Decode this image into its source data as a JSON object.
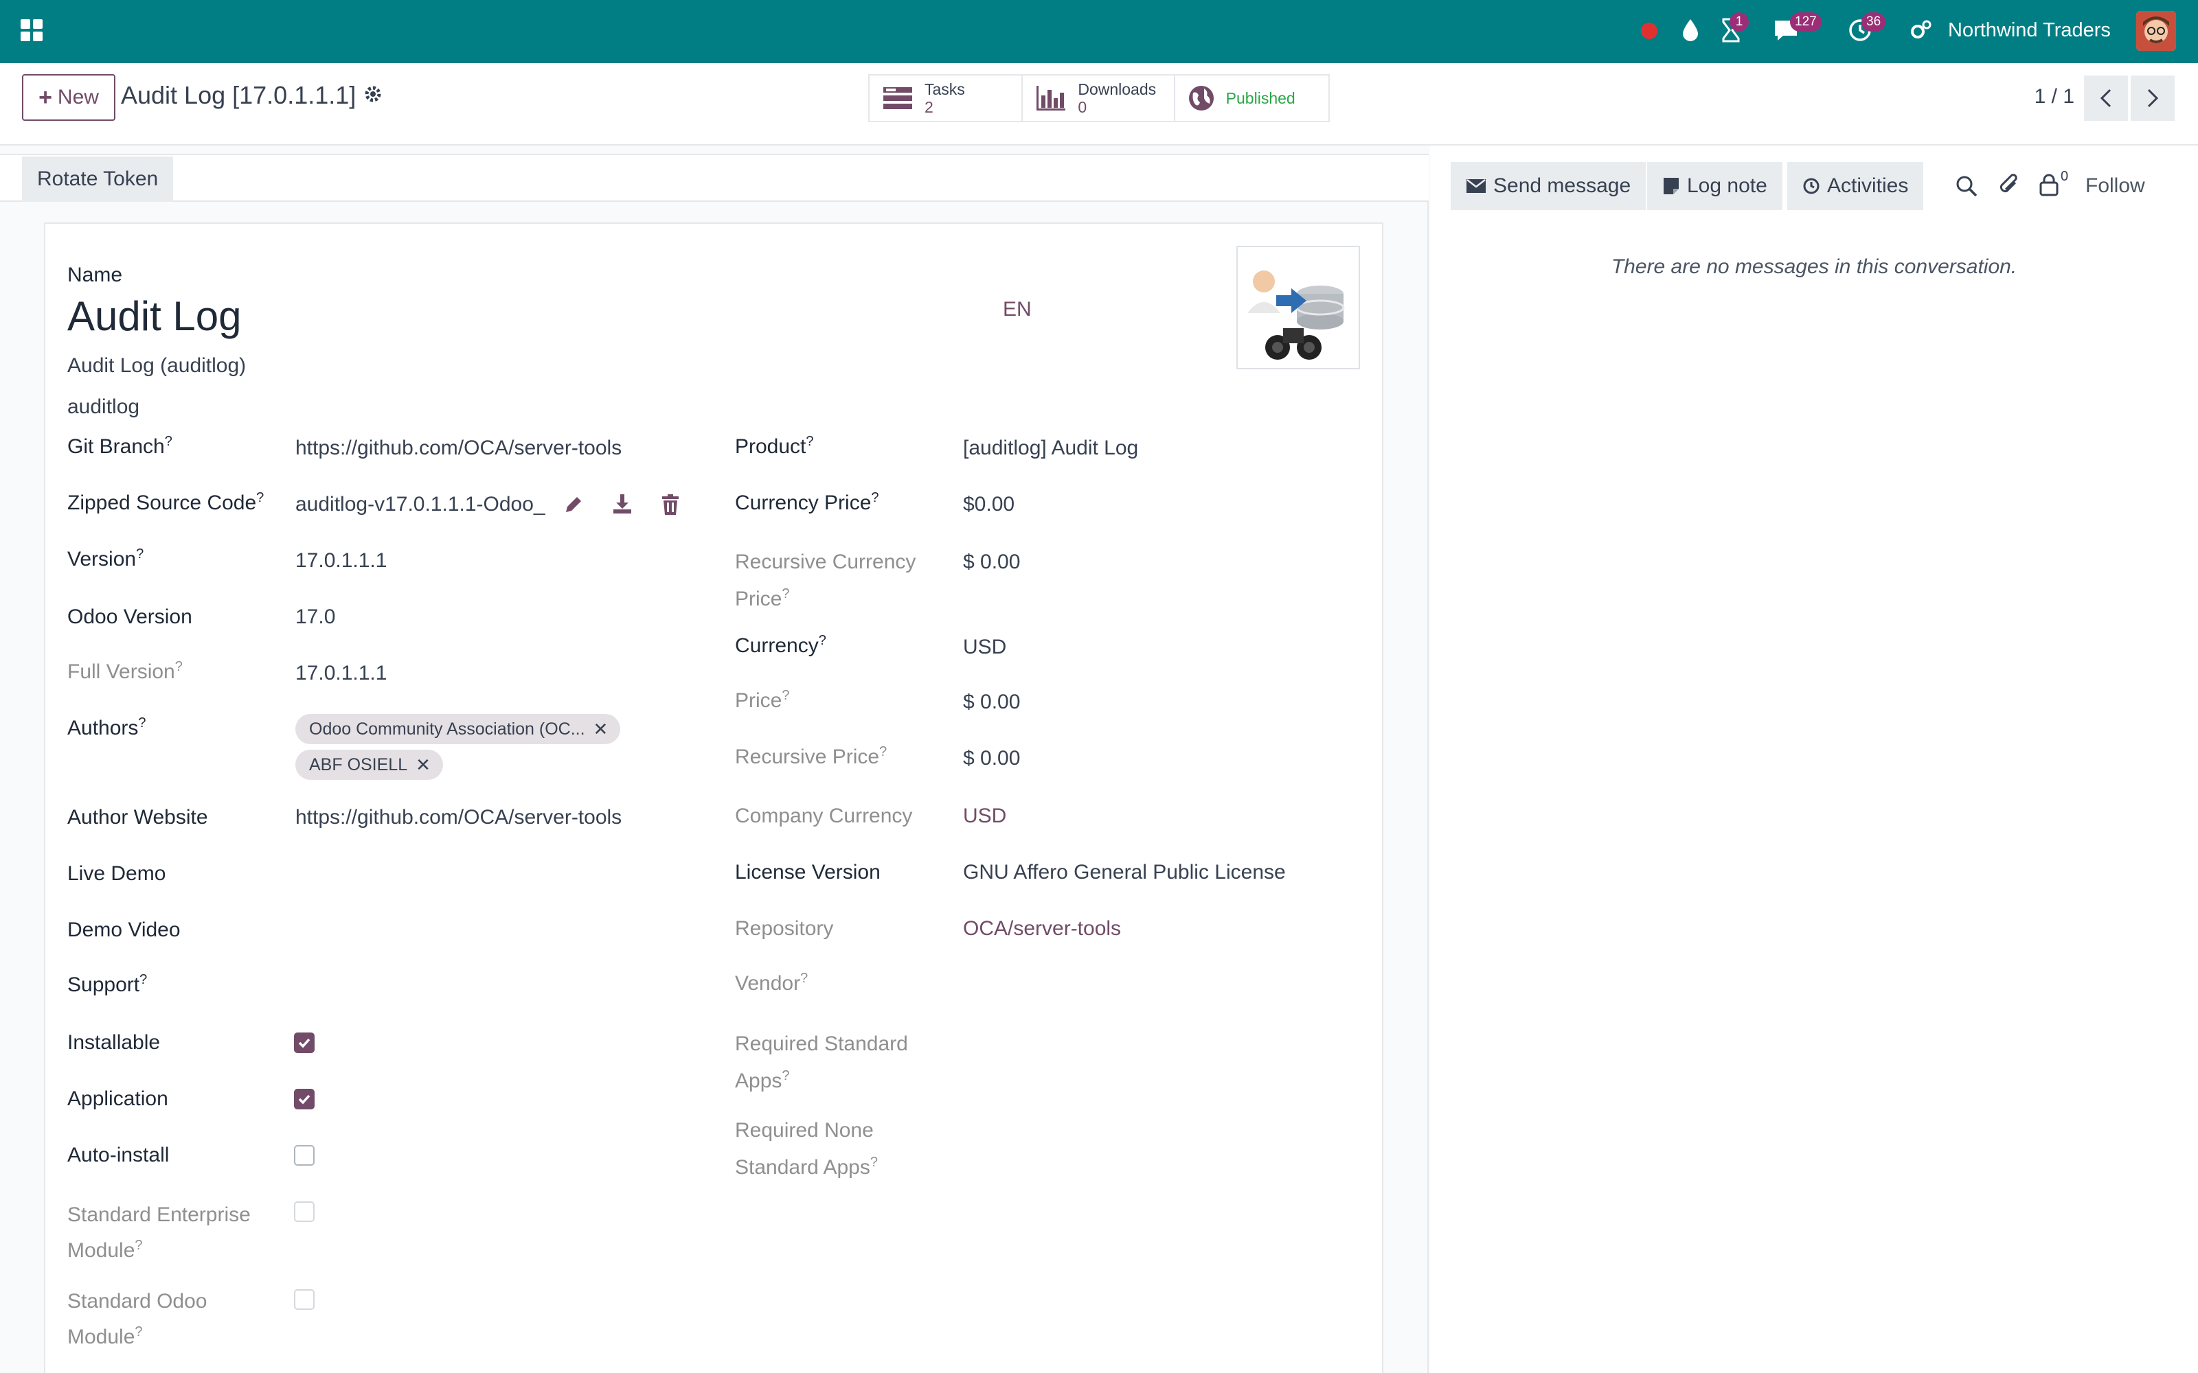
{
  "topbar": {
    "activity_badge": "1",
    "messages_badge": "127",
    "clock_badge": "36",
    "company": "Northwind Traders",
    "bg_color": "#017e84"
  },
  "control": {
    "new_label": "New",
    "record_title": "Audit Log [17.0.1.1.1]",
    "stats": [
      {
        "label": "Tasks",
        "value": "2"
      },
      {
        "label": "Downloads",
        "value": "0"
      },
      {
        "label": "Published",
        "value": ""
      }
    ],
    "pager": "1 / 1"
  },
  "status": {
    "rotate_label": "Rotate Token"
  },
  "form": {
    "name_label": "Name",
    "name_value": "Audit Log",
    "lang": "EN",
    "technical_name": "Audit Log (auditlog)",
    "slug": "auditlog",
    "left": {
      "git_branch": {
        "label": "Git Branch",
        "value": "https://github.com/OCA/server-tools"
      },
      "zipped": {
        "label": "Zipped Source Code",
        "value": "auditlog-v17.0.1.1.1-Odoo_"
      },
      "version": {
        "label": "Version",
        "value": "17.0.1.1.1"
      },
      "odoo_version": {
        "label": "Odoo Version",
        "value": "17.0"
      },
      "full_version": {
        "label": "Full Version",
        "value": "17.0.1.1.1"
      },
      "authors": {
        "label": "Authors",
        "tags": [
          "Odoo Community Association (OC...",
          "ABF OSIELL"
        ]
      },
      "author_website": {
        "label": "Author Website",
        "value": "https://github.com/OCA/server-tools"
      },
      "live_demo": {
        "label": "Live Demo"
      },
      "demo_video": {
        "label": "Demo Video"
      },
      "support": {
        "label": "Support"
      },
      "installable": {
        "label": "Installable",
        "checked": true
      },
      "application": {
        "label": "Application",
        "checked": true
      },
      "auto_install": {
        "label": "Auto-install",
        "checked": false
      },
      "std_enterprise": {
        "label_1": "Standard Enterprise",
        "label_2": "Module",
        "checked": false
      },
      "std_odoo": {
        "label_1": "Standard Odoo",
        "label_2": "Module",
        "checked": false
      }
    },
    "right": {
      "product": {
        "label": "Product",
        "value": "[auditlog] Audit Log"
      },
      "currency_price": {
        "label": "Currency Price",
        "value": "$0.00"
      },
      "rec_currency_price": {
        "label_1": "Recursive Currency",
        "label_2": "Price",
        "value": "$ 0.00"
      },
      "currency": {
        "label": "Currency",
        "value": "USD"
      },
      "price": {
        "label": "Price",
        "value": "$ 0.00"
      },
      "recursive_price": {
        "label": "Recursive Price",
        "value": "$ 0.00"
      },
      "company_currency": {
        "label": "Company Currency",
        "value": "USD"
      },
      "license_version": {
        "label": "License Version",
        "value": "GNU Affero General Public License"
      },
      "repository": {
        "label": "Repository",
        "value": "OCA/server-tools"
      },
      "vendor": {
        "label": "Vendor"
      },
      "req_std_apps": {
        "label_1": "Required Standard",
        "label_2": "Apps"
      },
      "req_none_std_apps": {
        "label_1": "Required None",
        "label_2": "Standard Apps"
      }
    }
  },
  "chatter": {
    "send_message": "Send message",
    "log_note": "Log note",
    "activities": "Activities",
    "followers_count": "0",
    "follow": "Follow",
    "empty": "There are no messages in this conversation."
  },
  "colors": {
    "primary": "#714b67",
    "teal": "#017e84",
    "published": "#28a745"
  }
}
